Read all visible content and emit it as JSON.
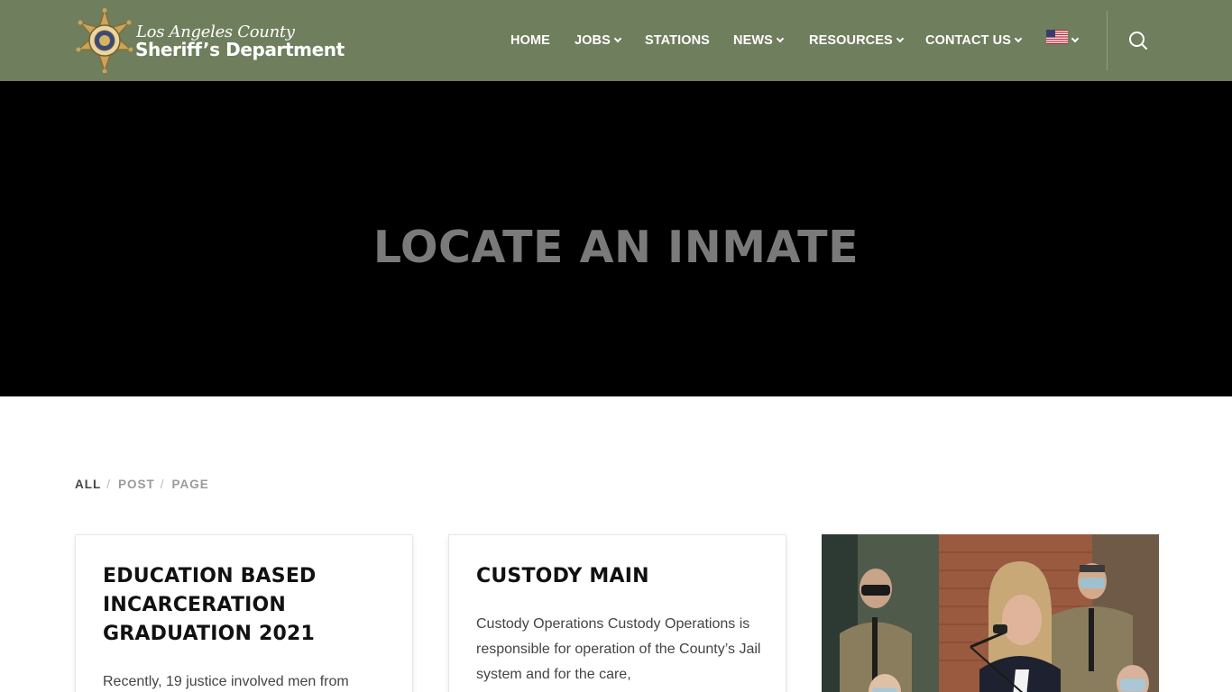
{
  "header": {
    "logo": {
      "line1": "Los Angeles County",
      "line2": "Sheriff’s Department",
      "badge_text": "SHERIFF"
    },
    "nav": [
      {
        "label": "HOME",
        "has_dropdown": false
      },
      {
        "label": "JOBS",
        "has_dropdown": true
      },
      {
        "label": "STATIONS",
        "has_dropdown": false
      },
      {
        "label": "NEWS",
        "has_dropdown": true
      },
      {
        "label": "RESOURCES",
        "has_dropdown": true
      },
      {
        "label": "CONTACT US",
        "has_dropdown": true
      }
    ],
    "language_icon": "us-flag-icon",
    "search_icon": "search-icon",
    "bg_color": "#6f7e5c"
  },
  "hero": {
    "title": "LOCATE AN INMATE"
  },
  "filters": {
    "items": [
      "ALL",
      "POST",
      "PAGE"
    ],
    "active": "ALL"
  },
  "cards": [
    {
      "title": "EDUCATION BASED INCARCERATION GRADUATION 2021",
      "excerpt": "Recently, 19 justice involved men from"
    },
    {
      "title": "CUSTODY MAIN",
      "excerpt": "Custody Operations Custody Operations is responsible for operation of the County’s Jail system and for the care,"
    },
    {
      "image": "photo of a woman speaking at a podium microphone in front of uniformed officers"
    }
  ]
}
